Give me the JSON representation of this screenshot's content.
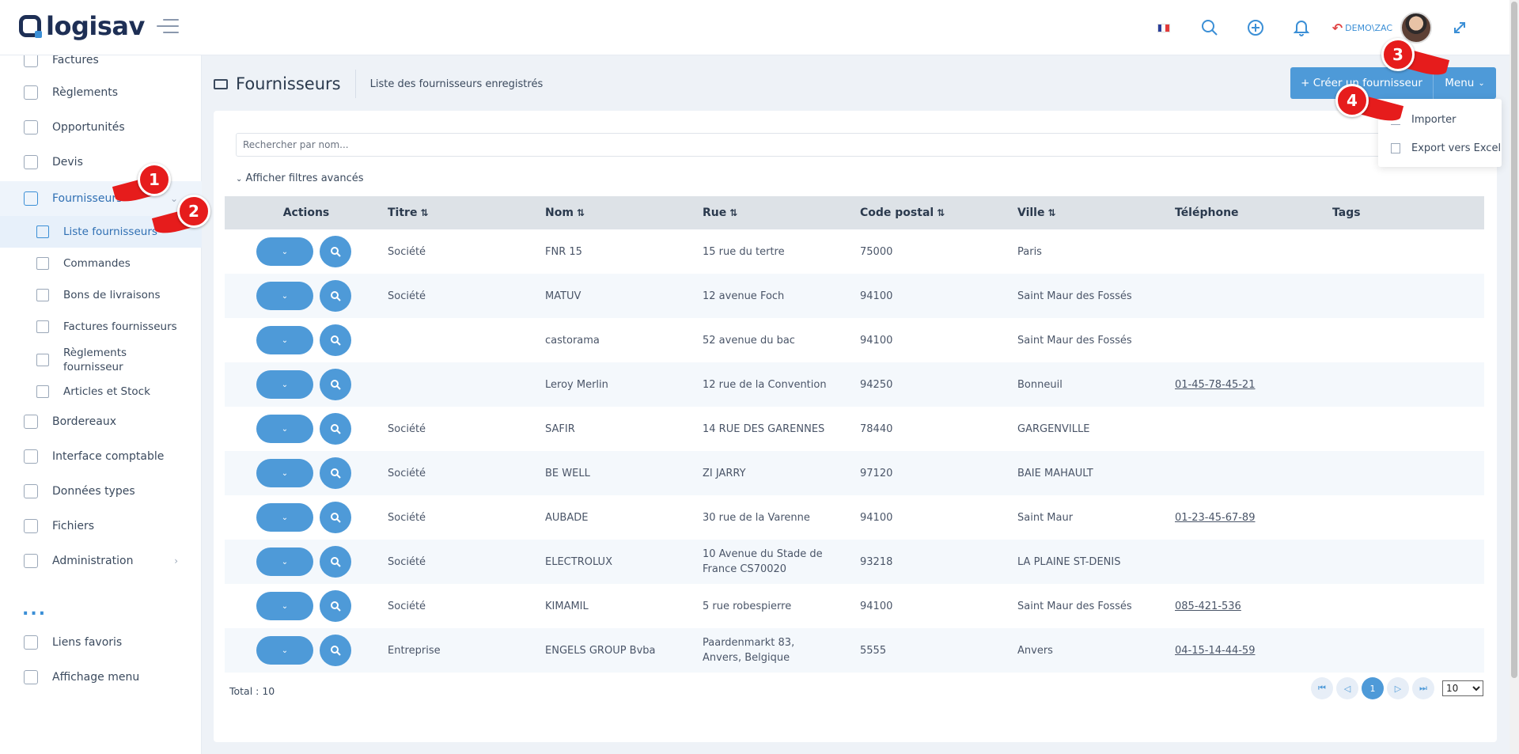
{
  "header": {
    "logo_text": "logisav",
    "user_label": "DEMO\\ZAC",
    "icons": [
      "flag-fr-icon",
      "search-icon",
      "plus-circle-icon",
      "bell-icon",
      "undo-icon",
      "avatar",
      "expand-icon"
    ]
  },
  "sidebar": {
    "items": [
      {
        "label": "Factures",
        "icon": "invoice-icon"
      },
      {
        "label": "Règlements",
        "icon": "payment-icon"
      },
      {
        "label": "Opportunités",
        "icon": "network-icon"
      },
      {
        "label": "Devis",
        "icon": "quote-icon"
      },
      {
        "label": "Fournisseurs",
        "icon": "truck-icon"
      },
      {
        "label": "Bordereaux",
        "icon": "slip-icon"
      },
      {
        "label": "Interface comptable",
        "icon": "external-link-icon"
      },
      {
        "label": "Données types",
        "icon": "grid-plus-icon"
      },
      {
        "label": "Fichiers",
        "icon": "folder-icon"
      },
      {
        "label": "Administration",
        "icon": "sliders-icon"
      },
      {
        "label": "Liens favoris",
        "icon": "link-icon"
      },
      {
        "label": "Affichage menu",
        "icon": "list-check-icon"
      }
    ],
    "sub_items": [
      {
        "label": "Liste fournisseurs"
      },
      {
        "label": "Commandes"
      },
      {
        "label": "Bons de livraisons"
      },
      {
        "label": "Factures fournisseurs"
      },
      {
        "label": "Règlements fournisseur"
      },
      {
        "label": "Articles et Stock"
      }
    ],
    "more": "..."
  },
  "page": {
    "title": "Fournisseurs",
    "subtitle": "Liste des fournisseurs enregistrés",
    "create_button": "+ Créer un fournisseur",
    "menu_button": "Menu",
    "dropdown": [
      "Importer",
      "Export vers Excel"
    ]
  },
  "search": {
    "placeholder": "Rechercher par nom..."
  },
  "advanced_filters": "Afficher filtres avancés",
  "table": {
    "headers": [
      "Actions",
      "Titre",
      "Nom",
      "Rue",
      "Code postal",
      "Ville",
      "Téléphone",
      "Tags"
    ],
    "rows": [
      [
        "Société",
        "FNR 15",
        "15 rue du tertre",
        "75000",
        "Paris",
        ""
      ],
      [
        "Société",
        "MATUV",
        "12 avenue Foch",
        "94100",
        "Saint Maur des Fossés",
        ""
      ],
      [
        "",
        "castorama",
        "52 avenue du bac",
        "94100",
        "Saint Maur des Fossés",
        ""
      ],
      [
        "",
        "Leroy Merlin",
        "12 rue de la Convention",
        "94250",
        "Bonneuil",
        "01-45-78-45-21"
      ],
      [
        "Société",
        "SAFIR",
        "14 RUE DES GARENNES",
        "78440",
        "GARGENVILLE",
        ""
      ],
      [
        "Société",
        "BE WELL",
        "ZI JARRY",
        "97120",
        "BAIE MAHAULT",
        ""
      ],
      [
        "Société",
        "AUBADE",
        "30 rue de la Varenne",
        "94100",
        "Saint Maur",
        "01-23-45-67-89"
      ],
      [
        "Société",
        "ELECTROLUX",
        "10 Avenue du Stade de France CS70020",
        "93218",
        "LA PLAINE ST-DENIS",
        ""
      ],
      [
        "Société",
        "KIMAMIL",
        "5 rue robespierre",
        "94100",
        "Saint Maur des Fossés",
        "085-421-536"
      ],
      [
        "Entreprise",
        "ENGELS GROUP Bvba",
        "Paardenmarkt 83, Anvers, Belgique",
        "5555",
        "Anvers",
        "04-15-14-44-59"
      ]
    ]
  },
  "footer": {
    "total": "Total : 10",
    "current_page": "1",
    "per_page": "10"
  },
  "markers": [
    "1",
    "2",
    "3",
    "4"
  ],
  "colors": {
    "accent": "#4e9ad8",
    "marker": "#e61c1c",
    "header_row": "#dde2e7"
  }
}
